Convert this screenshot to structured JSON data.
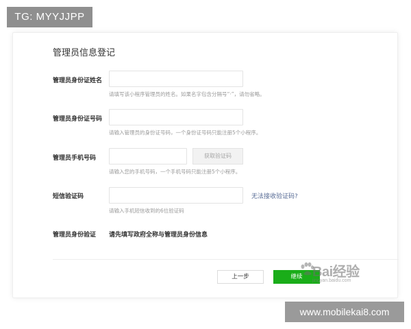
{
  "watermark_top": "TG: MYYJJPP",
  "watermark_bottom": "www.mobilekai8.com",
  "form": {
    "title": "管理员信息登记",
    "name": {
      "label": "管理员身份证姓名",
      "value": "",
      "hint": "请填写该小程序管理员的姓名。如果名字包含分隔号“·”，请勿省略。"
    },
    "id_number": {
      "label": "管理员身份证号码",
      "value": "",
      "hint": "请输入管理员的身份证号码，一个身份证号码只能注册5个小程序。"
    },
    "phone": {
      "label": "管理员手机号码",
      "value": "",
      "verify_button": "获取验证码",
      "hint": "请输入您的手机号码，一个手机号码只能注册5个小程序。"
    },
    "sms_code": {
      "label": "短信验证码",
      "value": "",
      "help_link": "无法接收验证码?",
      "hint": "请输入手机短信收到的6位验证码"
    },
    "identity_verify": {
      "label": "管理员身份验证",
      "text": "请先填写政府全称与管理员身份信息"
    }
  },
  "footer": {
    "prev_label": "上一步",
    "next_label": "继续"
  },
  "brand_watermark": {
    "logo_text": "Bai经验",
    "sub_text": "jingyan.baidu.com"
  },
  "colors": {
    "primary_green": "#1aad19",
    "link_blue": "#576b95",
    "hint_gray": "#9a9a9a"
  }
}
